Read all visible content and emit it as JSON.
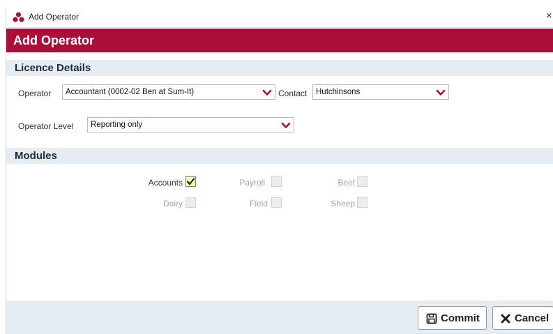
{
  "window": {
    "title": "Add Operator",
    "close_glyph": "×",
    "app_icon": "three-circles-logo-icon"
  },
  "header": {
    "title": "Add Operator",
    "color": "#a8103a"
  },
  "licence": {
    "section_title": "Licence Details",
    "operator_label": "Operator",
    "operator_value": "Accountant (0002-02 Ben at Sum-It)",
    "contact_label": "Contact",
    "contact_value": "Hutchinsons",
    "level_label": "Operator Level",
    "level_value": "Reporting only"
  },
  "modules": {
    "section_title": "Modules",
    "items": [
      {
        "label": "Accounts",
        "checked": true,
        "enabled": true
      },
      {
        "label": "Payroll",
        "checked": false,
        "enabled": false
      },
      {
        "label": "Beef",
        "checked": false,
        "enabled": false
      },
      {
        "label": "Dairy",
        "checked": false,
        "enabled": false
      },
      {
        "label": "Field",
        "checked": false,
        "enabled": false
      },
      {
        "label": "Sheep",
        "checked": false,
        "enabled": false
      }
    ]
  },
  "footer": {
    "commit_label": "Commit",
    "cancel_label": "Cancel"
  }
}
